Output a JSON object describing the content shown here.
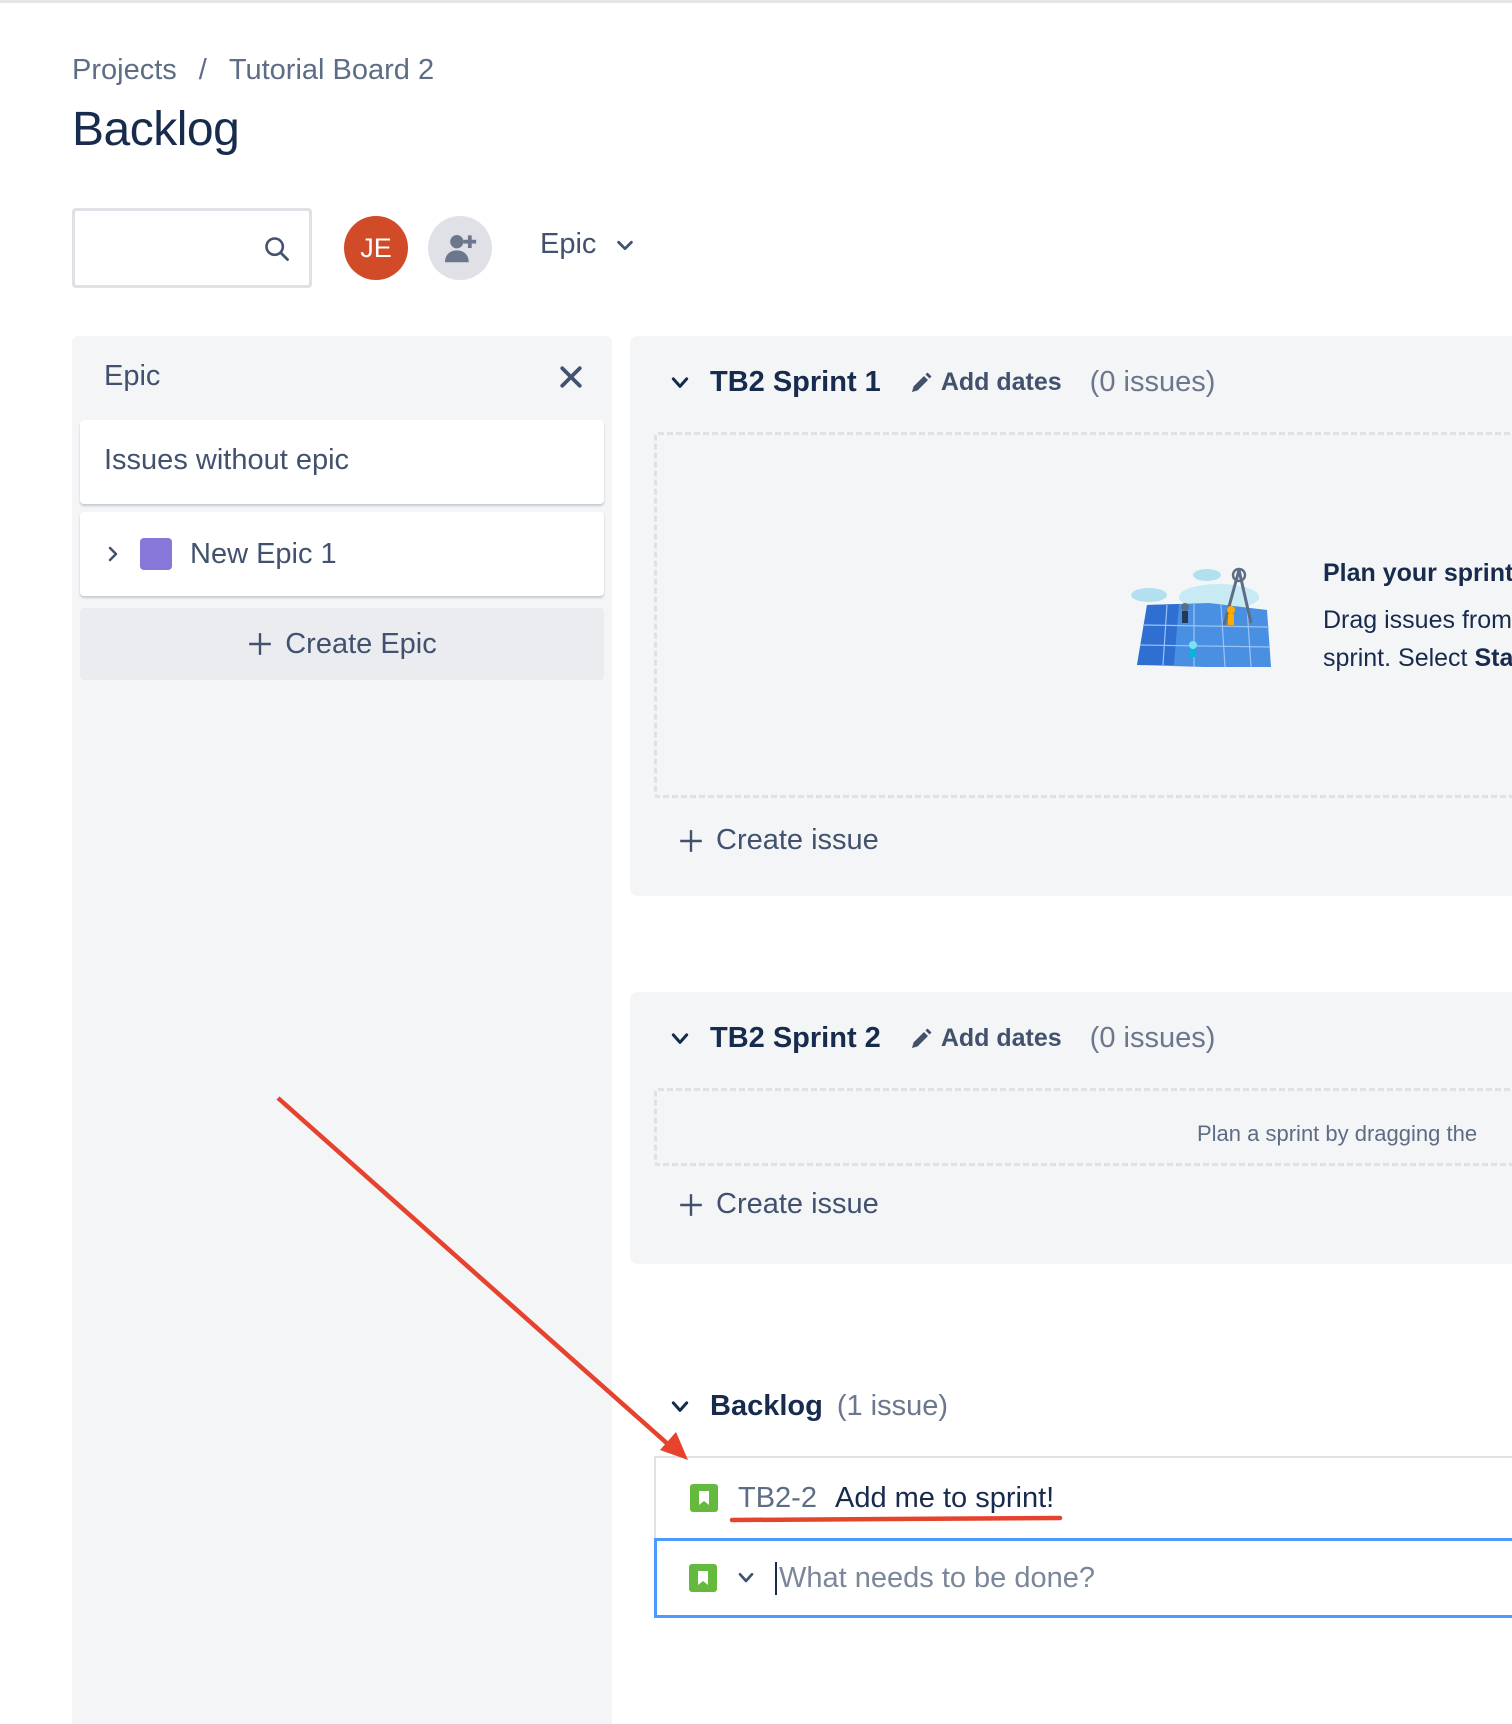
{
  "breadcrumb": {
    "projects": "Projects",
    "separator": "/",
    "board": "Tutorial Board 2"
  },
  "page_title": "Backlog",
  "toolbar": {
    "search_value": "",
    "avatar_initials": "JE",
    "epic_filter_label": "Epic"
  },
  "epic_panel": {
    "title": "Epic",
    "issues_without_epic": "Issues without epic",
    "epics": [
      {
        "name": "New Epic 1",
        "color": "#8777d9"
      }
    ],
    "create_epic": "Create Epic"
  },
  "sprints": [
    {
      "name": "TB2 Sprint 1",
      "add_dates": "Add dates",
      "count": "(0 issues)",
      "empty_title": "Plan your sprint",
      "empty_text_line1": "Drag issues from",
      "empty_text_line2": "sprint. Select ",
      "empty_text_bold": "Sta",
      "create_issue": "Create issue"
    },
    {
      "name": "TB2 Sprint 2",
      "add_dates": "Add dates",
      "count": "(0 issues)",
      "hint": "Plan a sprint by dragging the",
      "create_issue": "Create issue"
    }
  ],
  "backlog": {
    "name": "Backlog",
    "count": "(1 issue)",
    "issues": [
      {
        "key": "TB2-2",
        "summary": "Add me to sprint!"
      }
    ],
    "new_issue_placeholder": "What needs to be done?"
  },
  "colors": {
    "accent": "#4c9aff",
    "annotation": "#e5432d",
    "story": "#63ba3c",
    "avatar": "#d14b29"
  }
}
